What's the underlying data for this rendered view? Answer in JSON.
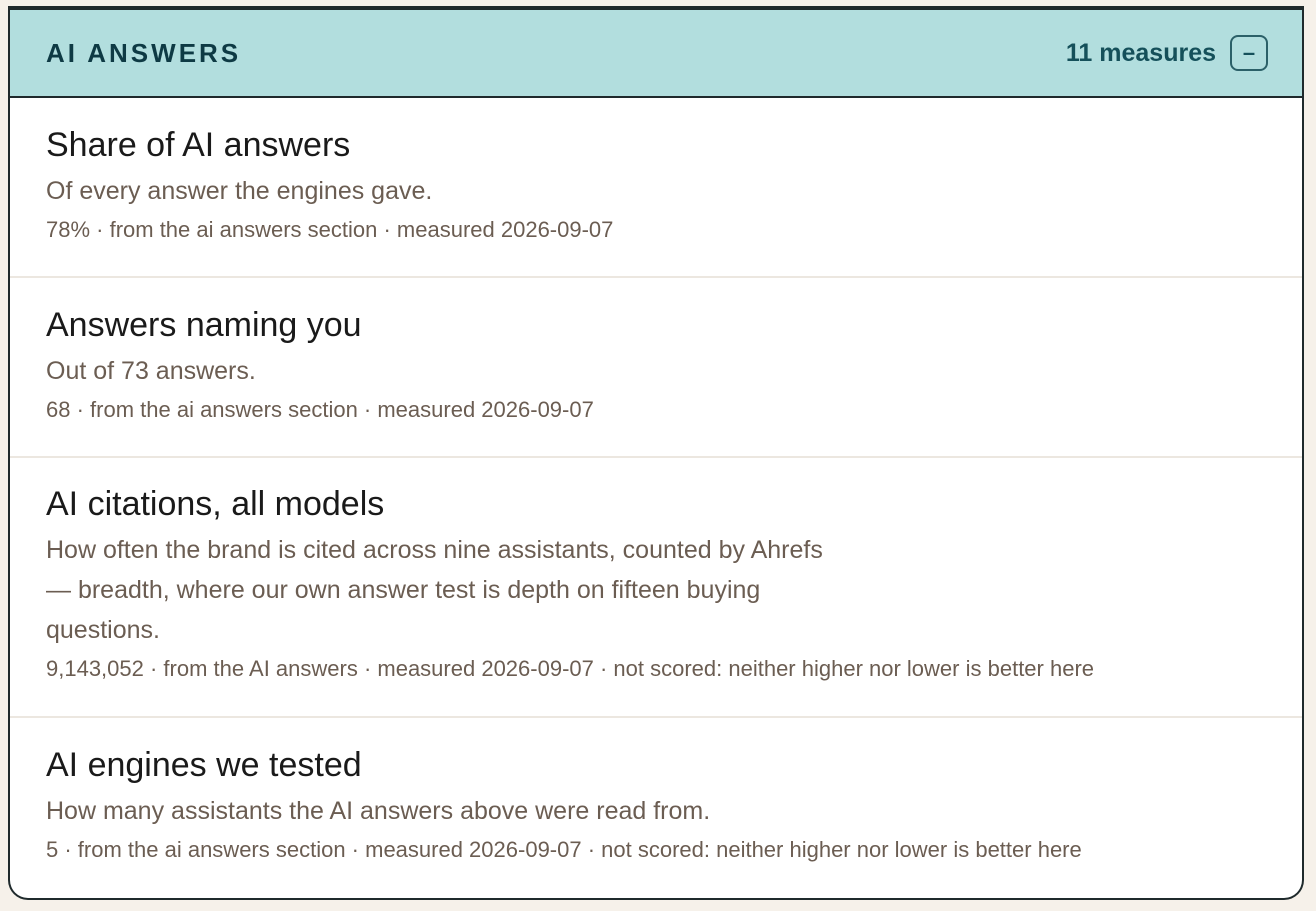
{
  "section": {
    "title": "AI ANSWERS",
    "measure_count": "11 measures",
    "collapse_label": "–"
  },
  "items": [
    {
      "title": "Share of AI answers",
      "description": [
        "Of every answer the engines gave."
      ],
      "meta": "78% · from the ai answers section · measured 2026-09-07"
    },
    {
      "title": "Answers naming you",
      "description": [
        "Out of 73 answers."
      ],
      "meta": "68 · from the ai answers section · measured 2026-09-07"
    },
    {
      "title": "AI citations, all models",
      "description": [
        "How often the brand is cited across nine assistants, counted by Ahrefs",
        "— breadth, where our own answer test is depth on fifteen buying",
        "questions."
      ],
      "meta": "9,143,052 · from the AI answers · measured 2026-09-07 · not scored: neither higher nor lower is better here"
    },
    {
      "title": "AI engines we tested",
      "description": [
        "How many assistants the AI answers above were read from."
      ],
      "meta": "5 · from the ai answers section · measured 2026-09-07 · not scored: neither higher nor lower is better here"
    }
  ],
  "colors": {
    "header_bg": "#b2dede",
    "title_color": "#0e3a44",
    "muted_text": "#6b5d52"
  },
  "icons": {
    "collapse": "minus-icon"
  }
}
